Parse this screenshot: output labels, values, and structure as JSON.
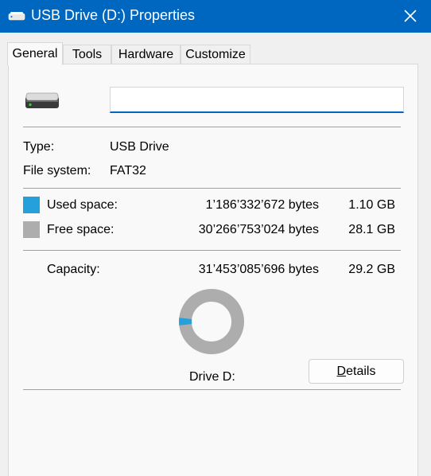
{
  "window": {
    "title": "USB Drive (D:) Properties",
    "accent": "#0067c0"
  },
  "tabs": [
    {
      "label": "General",
      "active": true
    },
    {
      "label": "Tools",
      "active": false
    },
    {
      "label": "Hardware",
      "active": false
    },
    {
      "label": "Customize",
      "active": false
    }
  ],
  "general": {
    "drive_icon": "usb-drive-icon",
    "name_value": "",
    "type_label": "Type:",
    "type_value": "USB Drive",
    "filesystem_label": "File system:",
    "filesystem_value": "FAT32",
    "used": {
      "label": "Used space:",
      "bytes": "1’186’332’672 bytes",
      "size": "1.10 GB",
      "color": "#26a0da"
    },
    "free": {
      "label": "Free space:",
      "bytes": "30’266’753’024 bytes",
      "size": "28.1 GB",
      "color": "#adadad"
    },
    "capacity": {
      "label": "Capacity:",
      "bytes": "31’453’085’696 bytes",
      "size": "29.2 GB"
    },
    "used_fraction": 0.0377,
    "drive_label": "Drive D:",
    "details_button": {
      "label_prefix": "",
      "label_access": "D",
      "label_rest": "etails"
    }
  }
}
